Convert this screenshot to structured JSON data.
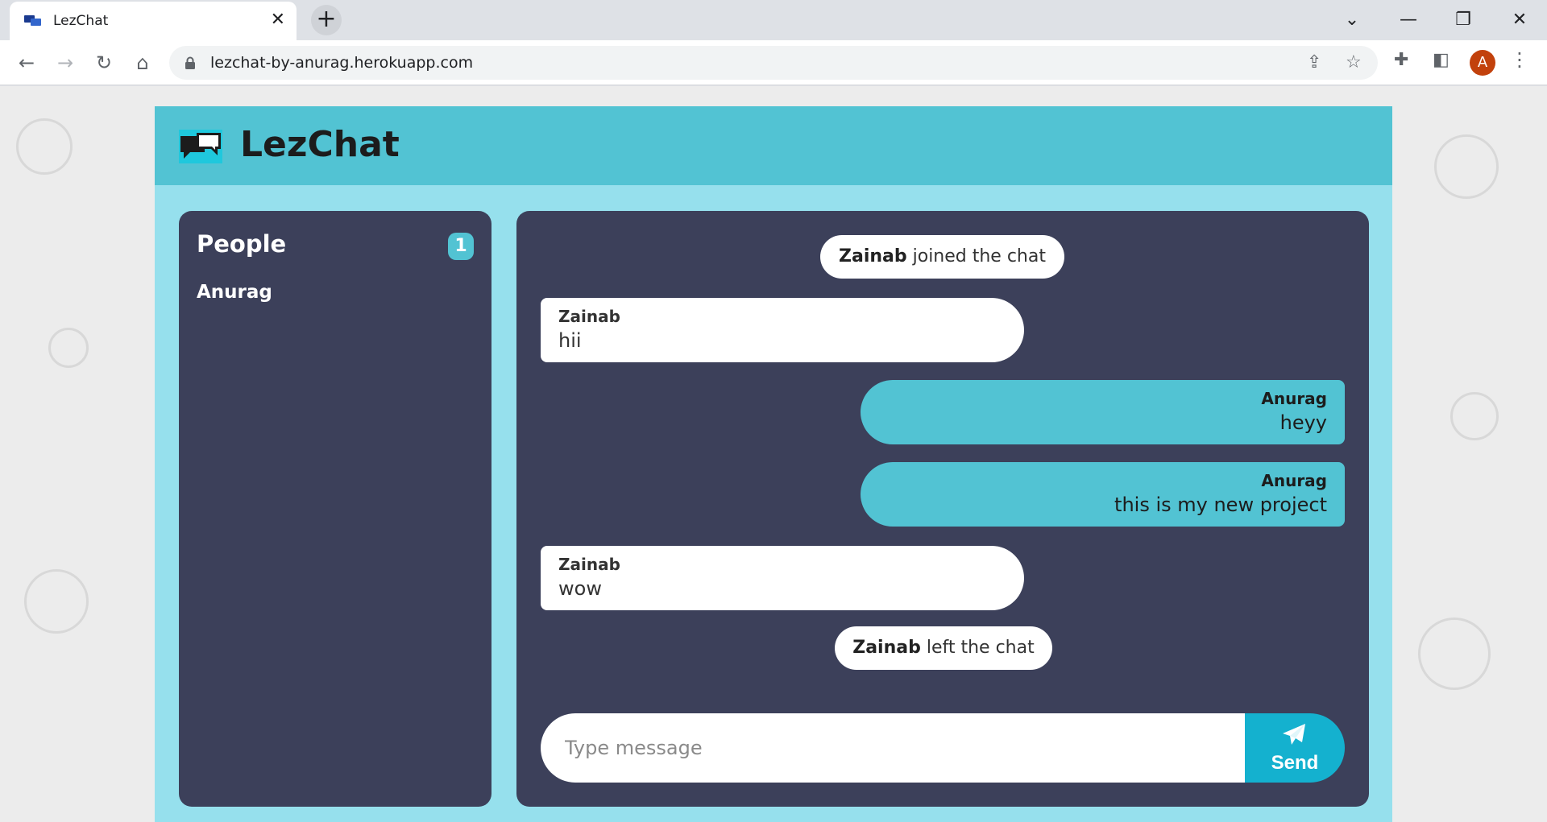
{
  "browser": {
    "tab_title": "LezChat",
    "tab_close": "✕",
    "new_tab": "+",
    "url": "lezchat-by-anurag.herokuapp.com",
    "profile_initial": "A",
    "icons": [
      "back-arrow-icon",
      "forward-arrow-icon",
      "reload-icon",
      "home-icon",
      "lock-icon",
      "share-icon",
      "star-icon",
      "extensions-icon",
      "side-panel-icon",
      "more-menu-icon",
      "minimize-icon",
      "restore-icon",
      "close-icon",
      "tab-search-icon"
    ]
  },
  "app": {
    "title": "LezChat",
    "accent_color": "#52c3d3",
    "panel_color": "#3c405a",
    "background_color": "#96e0ed"
  },
  "people": {
    "title": "People",
    "count": "1",
    "list": [
      "Anurag"
    ]
  },
  "chat": {
    "notices": [
      {
        "name": "Zainab",
        "text": " joined the chat"
      },
      {
        "name": "Zainab",
        "text": " left the chat"
      }
    ],
    "messages": [
      {
        "sender": "Zainab",
        "text": "hii",
        "direction": "incoming"
      },
      {
        "sender": "Anurag",
        "text": "heyy",
        "direction": "outgoing"
      },
      {
        "sender": "Anurag",
        "text": "this is my new project",
        "direction": "outgoing"
      },
      {
        "sender": "Zainab",
        "text": "wow",
        "direction": "incoming"
      }
    ]
  },
  "composer": {
    "placeholder": "Type message",
    "value": "",
    "send_label": "Send"
  }
}
